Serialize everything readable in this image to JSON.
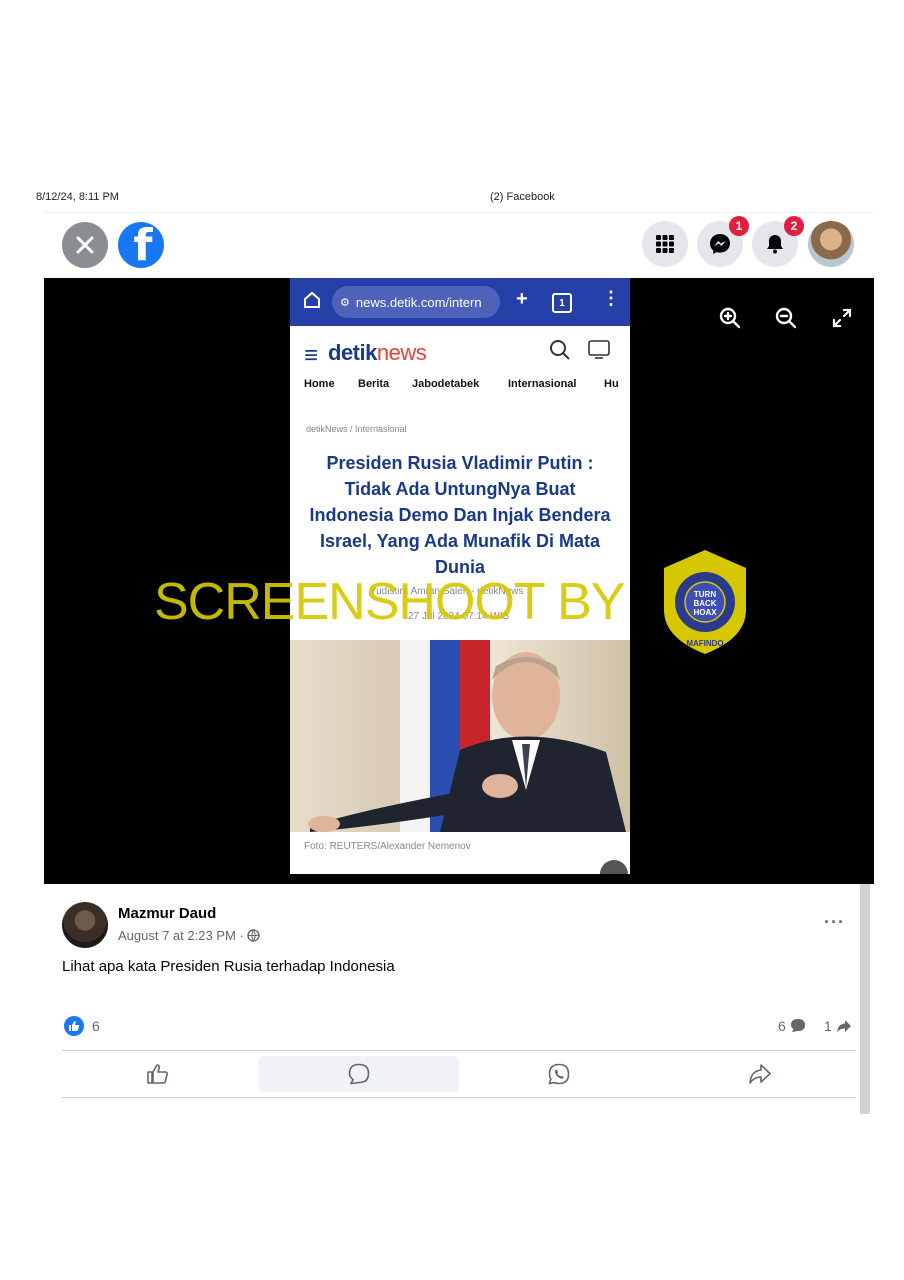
{
  "print_header": {
    "datetime": "8/12/24, 8:11 PM",
    "page_title": "(2) Facebook"
  },
  "topbar": {
    "messenger_badge": "1",
    "notifications_badge": "2"
  },
  "phone": {
    "url": "news.detik.com/intern",
    "tabs_count": "1",
    "logo_main": "detik",
    "logo_sub": "news",
    "nav": [
      "Home",
      "Berita",
      "Jabodetabek",
      "Internasional",
      "Hu"
    ],
    "breadcrumb": "detikNews / Internasional",
    "headline": "Presiden Rusia Vladimir Putin : Tidak Ada UntungNya Buat Indonesia Demo Dan Injak Bendera Israel, Yang Ada Munafik Di Mata Dunia",
    "byline": "Yudistira Amran Saleh - detikNews",
    "dateline": "27 Jul 2024 07:14 WIB",
    "caption": "Foto: REUTERS/Alexander Nemenov"
  },
  "watermark": {
    "text": "SCREENSHOOT BY",
    "seal_ring": "MASYARAKAT ANTI FITNAH INDONESIA",
    "seal_center": "TURN BACK HOAX",
    "seal_bottom": "MAFINDO"
  },
  "post": {
    "author": "Mazmur Daud",
    "time": "August 7 at 2:23 PM · ",
    "text": "Lihat apa kata Presiden Rusia terhadap Indonesia",
    "likes": "6",
    "comments": "6",
    "shares": "1"
  },
  "colors": {
    "facebook_blue": "#1877f2",
    "detik_blue": "#1b3a86",
    "watermark_yellow": "#d6c800"
  }
}
